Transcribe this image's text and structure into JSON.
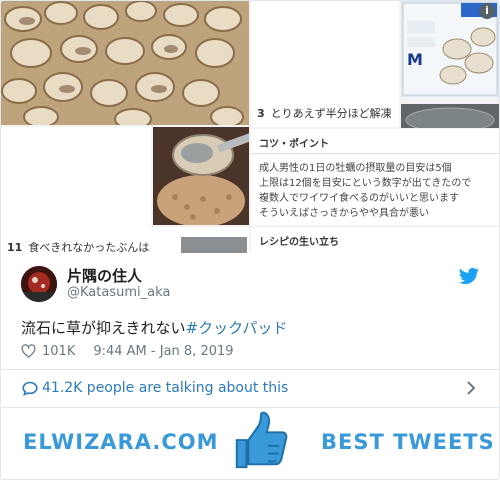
{
  "embed": {
    "steps": [
      {
        "num": "3",
        "text": "とりあえず半分ほど解凍"
      },
      {
        "num": "11",
        "text": "食べきれなかったぶんは"
      }
    ],
    "tips": {
      "title": "コツ・ポイント",
      "lines": [
        "成人男性の1日の牡蠣の摂取量の目安は5個",
        "上限は12個を目安にという数字が出てきたので",
        "複数人でワイワイ食べるのがいいと思います",
        "そういえばさっきからやや具合が悪い"
      ]
    },
    "origin_title": "レシピの生い立ち",
    "package_label": "M"
  },
  "tweet": {
    "display_name": "片隅の住人",
    "handle": "@Katasumi_aka",
    "text": "流石に草が抑えきれない",
    "hashtag": "#クックパッド",
    "likes": "101K",
    "timestamp": "9:44 AM - Jan 8, 2019",
    "talking": "41.2K people are talking about this"
  },
  "banner": {
    "left": "ELWIZARA.COM",
    "right": "BEST TWEETS"
  },
  "colors": {
    "link": "#2b7bb9",
    "brand": "#3a9ad9",
    "text": "#1c2022",
    "muted": "#697882"
  }
}
